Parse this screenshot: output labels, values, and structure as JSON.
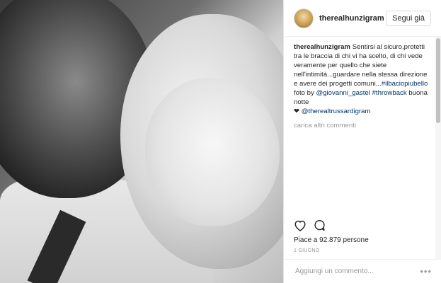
{
  "post": {
    "username": "therealhunzigram",
    "follow_label": "Segui già"
  },
  "caption": {
    "author": "therealhunzigram",
    "text1": "Sentirsi al sicuro,protetti tra le braccia di chi vi ha scelto, di chi vede veramente per quello che siete nell'intimità...guardare nella stessa direzione e avere dei progetti comuni...",
    "hashtag1": "#ilbaciopiubello",
    "text2": " foto by ",
    "mention1": "@giovanni_gastel",
    "text3": " ",
    "hashtag2": "#throwback",
    "text4": " buona notte",
    "heart": "❤",
    "mention2": "@therealtrussardigram"
  },
  "load_more": "carica altri commenti",
  "likes": "Piace a 92.879 persone",
  "date": "1 GIUGNO",
  "comment": {
    "placeholder": "Aggiungi un commento...",
    "more": "•••"
  },
  "icons": {
    "like": "heart-icon",
    "comment": "comment-icon",
    "options": "more-icon"
  }
}
